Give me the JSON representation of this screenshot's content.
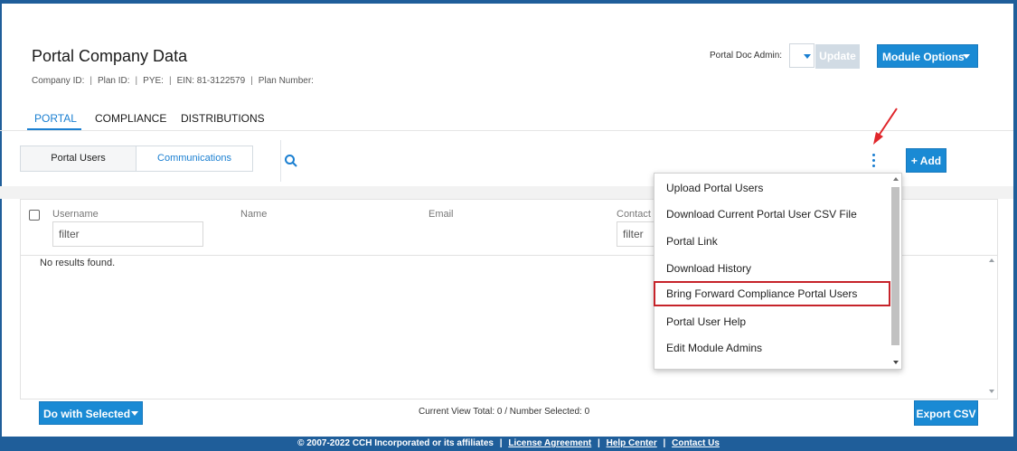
{
  "colors": {
    "accent": "#1a8ad4",
    "brand": "#1f5e9a",
    "highlight": "#c6232a",
    "arrow": "#e0262b"
  },
  "page": {
    "title": "Portal Company Data"
  },
  "meta": {
    "company_id": "Company ID:",
    "plan_id": "Plan ID:",
    "pye": "PYE:",
    "ein": "EIN: 81-3122579",
    "plan_number": "Plan Number:",
    "separator": "|"
  },
  "header": {
    "doc_admin_label": "Portal Doc Admin:",
    "update_label": "Update",
    "module_options_label": "Module Options"
  },
  "tabs": [
    {
      "label": "PORTAL",
      "active": true
    },
    {
      "label": "COMPLIANCE",
      "active": false
    },
    {
      "label": "DISTRIBUTIONS",
      "active": false
    }
  ],
  "subtabs": [
    {
      "label": "Portal Users",
      "active": true
    },
    {
      "label": "Communications",
      "active": false
    }
  ],
  "toolbar": {
    "search_icon": "search-icon",
    "kebab_icon": "kebab-menu-icon",
    "add_label": "+ Add"
  },
  "grid": {
    "columns": [
      {
        "label": "Username",
        "filter_value": "filter"
      },
      {
        "label": "Name"
      },
      {
        "label": "Email"
      },
      {
        "label": "Contact T",
        "filter_value": "filter"
      }
    ],
    "empty_message": "No results found."
  },
  "menu": {
    "items": [
      "Upload Portal Users",
      "Download Current Portal User CSV File",
      "Portal Link",
      "Download History",
      "Bring Forward Compliance Portal Users",
      "Portal User Help",
      "Edit Module Admins"
    ],
    "highlighted_index": 4
  },
  "bottom": {
    "do_with_selected_label": "Do with Selected",
    "view_total": "Current View Total: 0 / Number Selected: 0",
    "export_label": "Export CSV"
  },
  "footer": {
    "copyright": "© 2007-2022 CCH Incorporated or its affiliates",
    "links": [
      "License Agreement",
      "Help Center",
      "Contact Us"
    ],
    "separator": "|"
  }
}
